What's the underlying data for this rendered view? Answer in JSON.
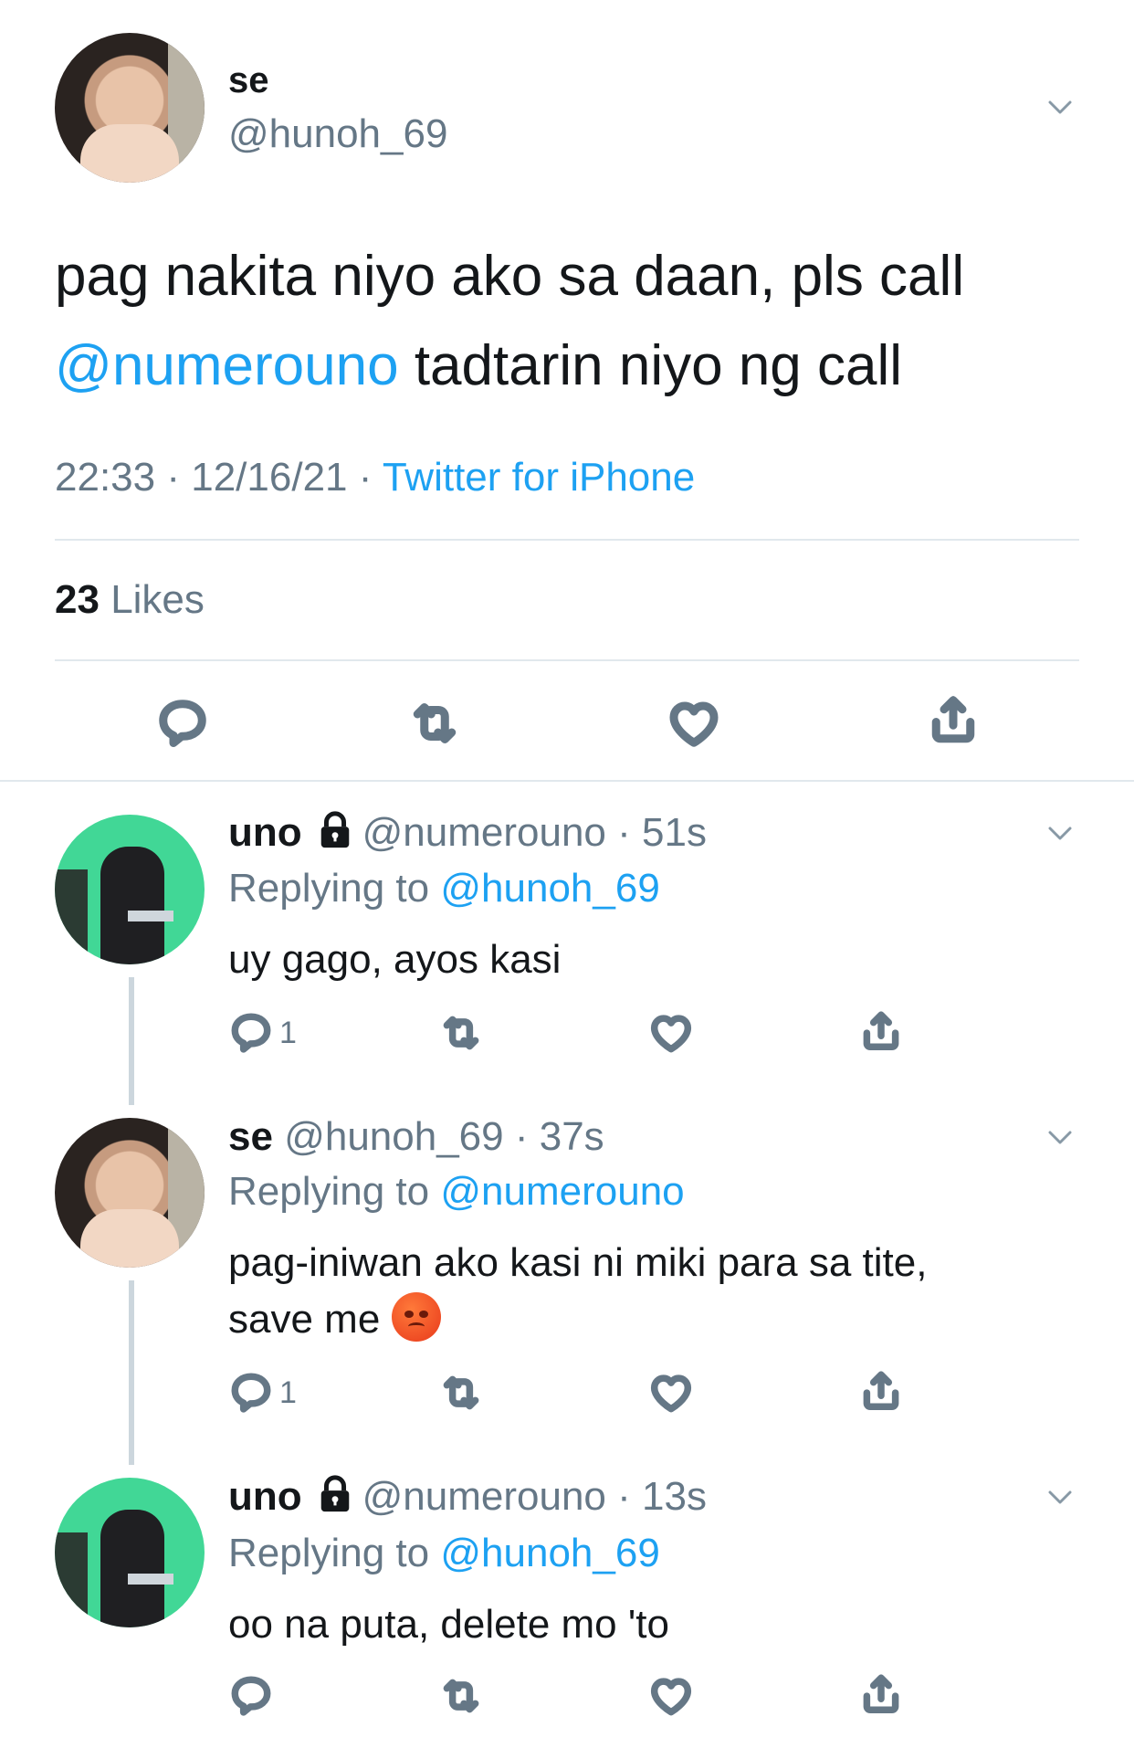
{
  "main_tweet": {
    "name": "se",
    "handle": "@hunoh_69",
    "text_part1": "pag nakita niyo ako sa daan, pls call",
    "mention": "@numerouno",
    "text_part2": " tadtarin niyo ng call",
    "time": "22:33",
    "date": "12/16/21",
    "separator": "·",
    "source": "Twitter for iPhone",
    "likes_count": "23",
    "likes_label": "Likes"
  },
  "replies": [
    {
      "name": "uno",
      "locked": true,
      "handle": "@numerouno",
      "time": "51s",
      "replying_prefix": "Replying to",
      "replying_to": "@hunoh_69",
      "text": "uy gago, ayos kasi",
      "reply_count": "1"
    },
    {
      "name": "se",
      "locked": false,
      "handle": "@hunoh_69",
      "time": "37s",
      "replying_prefix": "Replying to",
      "replying_to": "@numerouno",
      "text": "pag-iniwan ako kasi ni miki para sa tite,",
      "text_line2": "save me",
      "emoji": "angry-face",
      "reply_count": "1"
    },
    {
      "name": "uno",
      "locked": true,
      "handle": "@numerouno",
      "time": "13s",
      "replying_prefix": "Replying to",
      "replying_to": "@hunoh_69",
      "text": "oo na puta, delete mo 'to",
      "reply_count": ""
    }
  ],
  "icons": [
    "chevron-down-icon",
    "reply-icon",
    "retweet-icon",
    "like-icon",
    "share-icon",
    "lock-icon"
  ],
  "colors": {
    "link": "#1da1f2",
    "secondary": "#657786",
    "divider": "#e1e8ed"
  }
}
